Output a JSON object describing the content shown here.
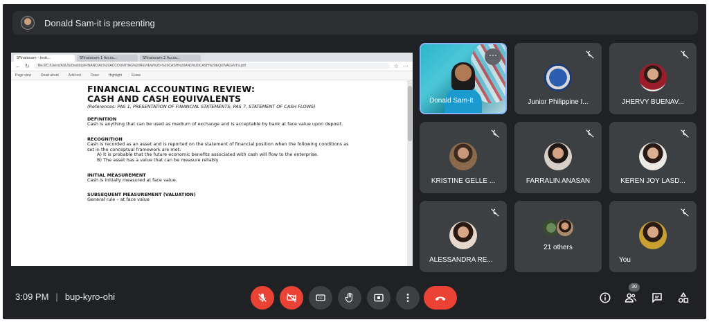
{
  "banner": {
    "presenting_text": "Donald Sam-it is presenting"
  },
  "browser": {
    "tabs": [
      "SFinalexam - Instr...",
      "SFinalexam 1 Accou...",
      "SFinalexam 2 Accou..."
    ],
    "url": "file:///C:/Users/ASUS/Desktop/FINANCIAL%20ACCOUNTING%20REVIEW%20-%20CASH%20AND%20CASH%20EQUIVALENTS.pdf",
    "pdf_tools": [
      "Page view",
      "Read aloud",
      "Add text",
      "Draw",
      "Highlight",
      "Erase"
    ]
  },
  "document": {
    "title_line1": "FINANCIAL ACCOUNTING REVIEW:",
    "title_line2": "CASH AND CASH EQUIVALENTS",
    "references": "(References: PAS 1, PRESENTATION OF FINANCIAL STATEMENTS; PAS 7, STATEMENT OF CASH FLOWS)",
    "definition_heading": "DEFINITION",
    "definition_text": "Cash is anything that can be used as medium of exchange and is acceptable by bank at face value upon deposit.",
    "recognition_heading": "RECOGNITION",
    "recognition_text": "Cash is recorded as an asset and is reported on the statement of financial position when the following conditions as set in the conceptual framework are met:",
    "recognition_a": "A)   It is probable that the future economic benefits associated with cash will flow to the enterprise.",
    "recognition_b": "B)   The asset has a value that can be measure reliably",
    "initial_heading": "INITIAL MEASUREMENT",
    "initial_text": "Cash is initially measured at face value.",
    "subsequent_heading": "SUBSEQUENT MEASUREMENT (VALUATION)",
    "subsequent_text": "General rule – at face value"
  },
  "participants": [
    {
      "name": "Donald Sam-it",
      "muted": false,
      "presenter": true
    },
    {
      "name": "Junior Philippine I...",
      "muted": true
    },
    {
      "name": "JHERVY BUENAV...",
      "muted": true
    },
    {
      "name": "KRISTINE GELLE ...",
      "muted": true
    },
    {
      "name": "FARRALIN ANASAN",
      "muted": true
    },
    {
      "name": "KEREN JOY LASD...",
      "muted": true
    },
    {
      "name": "ALESSANDRA RE...",
      "muted": true
    },
    {
      "name": "21 others",
      "muted": false
    },
    {
      "name": "You",
      "muted": true
    }
  ],
  "footer": {
    "time": "3:09 PM",
    "meeting_code": "bup-kyro-ohi",
    "participant_count": "30"
  },
  "colors": {
    "background": "#202124",
    "tile": "#3c4043",
    "danger": "#ea4335",
    "presenter_outline": "#8ab4f8"
  },
  "icons": {
    "mic": "mic-off-icon",
    "camera": "camera-off-icon",
    "captions": "captions-icon",
    "hand": "raise-hand-icon",
    "present": "present-screen-icon",
    "more": "more-options-icon",
    "end": "end-call-icon",
    "info": "info-icon",
    "people": "people-icon",
    "chat": "chat-icon",
    "activities": "activities-icon"
  }
}
